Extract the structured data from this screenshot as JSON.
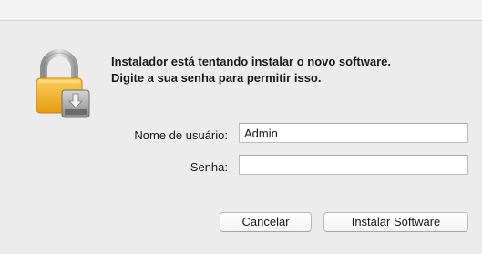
{
  "dialog": {
    "message_line1": "Instalador está tentando instalar o novo software.",
    "message_line2": "Digite a sua senha para permitir isso."
  },
  "form": {
    "username_label": "Nome de usuário:",
    "username_value": "Admin",
    "password_label": "Senha:",
    "password_value": ""
  },
  "buttons": {
    "cancel_label": "Cancelar",
    "install_label": "Instalar Software"
  },
  "icons": {
    "lock": "lock-icon",
    "installer": "installer-icon"
  },
  "colors": {
    "dialog_bg": "#ececec",
    "lock_gold": "#f0a81e",
    "field_border": "#bdbdbd"
  }
}
